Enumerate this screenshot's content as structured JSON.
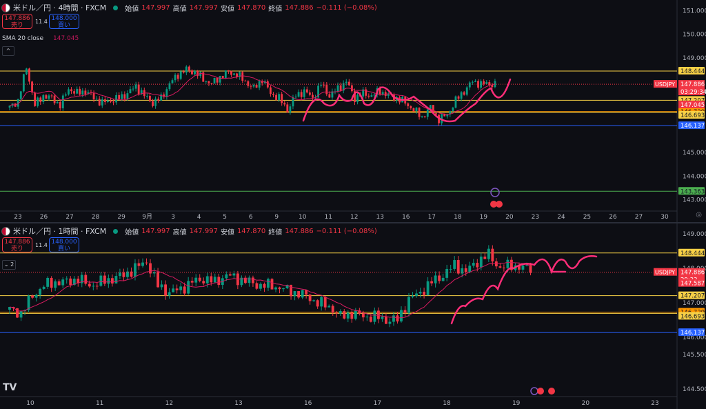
{
  "colors": {
    "background": "#0d0e14",
    "up": "#089981",
    "down": "#f23645",
    "sma": "#d81b60",
    "drawing": "#ff2d78",
    "yellow_line": "#f7d046",
    "orange_line": "#ff9800",
    "blue_line": "#2962ff",
    "green_line": "#4caf50"
  },
  "top": {
    "symbol": "米ドル／円 · 4時間 · FXCM",
    "open_label": "始値",
    "open": "147.997",
    "high_label": "高値",
    "high": "147.997",
    "low_label": "安値",
    "low": "147.870",
    "close_label": "終値",
    "close": "147.886",
    "change": "−0.111 (−0.08%)",
    "sell_price": "147.886",
    "sell_label": "売り",
    "spread": "11.4",
    "buy_price": "148.000",
    "buy_label": "買い",
    "sma_label": "SMA 20 close",
    "sma_value": "147.045",
    "collapse_icon": "^",
    "price_label_symbol": "USDJPY",
    "countdown": "03:29:34"
  },
  "bottom": {
    "symbol": "米ドル／円 · 1時間 · FXCM",
    "open_label": "始値",
    "open": "147.997",
    "high_label": "高値",
    "high": "147.997",
    "low_label": "安値",
    "low": "147.870",
    "close_label": "終値",
    "close": "147.886",
    "change": "−0.111 (−0.08%)",
    "sell_price": "147.886",
    "sell_label": "売り",
    "spread": "11.4",
    "buy_price": "148.000",
    "buy_label": "買い",
    "collapse_label": "⌄ 2",
    "price_label_symbol": "USDJPY",
    "countdown": "29:33",
    "logo": "TV"
  },
  "chart_data": [
    {
      "type": "candlestick",
      "title": "米ドル／円 · 4時間 · FXCM",
      "y_ticks": [
        "151.000",
        "150.000",
        "149.000",
        "145.000",
        "144.000",
        "143.000"
      ],
      "ylim": [
        142.7,
        151.3
      ],
      "x_ticks": [
        "23",
        "26",
        "27",
        "28",
        "29",
        "9月",
        "3",
        "4",
        "5",
        "6",
        "9",
        "10",
        "11",
        "12",
        "13",
        "16",
        "17",
        "18",
        "19",
        "20",
        "23",
        "24",
        "25",
        "26",
        "27",
        "30"
      ],
      "horizontal_levels": [
        {
          "value": 148.444,
          "label": "148.444",
          "color": "#f7d046"
        },
        {
          "value": 147.207,
          "label": "147.207",
          "color": "#f7d046"
        },
        {
          "value": 146.729,
          "label": "146.729",
          "color": "#ff9800"
        },
        {
          "value": 146.693,
          "label": "146.693",
          "color": "#f7d046"
        },
        {
          "value": 146.137,
          "label": "146.137",
          "color": "#2962ff"
        },
        {
          "value": 143.363,
          "label": "143.363",
          "color": "#4caf50"
        }
      ],
      "current_price": {
        "value": 147.886,
        "label": "147.886"
      },
      "sma_price": {
        "value": 147.045,
        "label": "147.045"
      },
      "close_path": [
        146.9,
        147.2,
        148.6,
        147.0,
        147.4,
        147.3,
        147.0,
        147.7,
        147.5,
        147.6,
        147.3,
        147.1,
        147.2,
        147.3,
        147.5,
        147.8,
        147.4,
        147.1,
        147.3,
        147.9,
        148.3,
        148.5,
        148.4,
        148.1,
        147.9,
        148.2,
        148.4,
        148.3,
        148.0,
        147.7,
        148.1,
        147.5,
        147.3,
        146.8,
        147.4,
        147.6,
        147.3,
        147.9,
        147.4,
        147.7,
        148.0,
        147.3,
        147.5,
        147.4,
        147.6,
        147.4,
        147.3,
        147.1,
        146.8,
        146.5,
        146.9,
        146.4,
        146.6,
        147.2,
        147.6,
        148.0,
        147.9,
        147.9
      ]
    },
    {
      "type": "candlestick",
      "title": "米ドル／円 · 1時間 · FXCM",
      "y_ticks": [
        "149.000",
        "148.000",
        "147.000",
        "146.000",
        "145.500",
        "144.500"
      ],
      "ylim": [
        144.4,
        149.2
      ],
      "x_ticks": [
        "10",
        "11",
        "12",
        "13",
        "16",
        "17",
        "18",
        "19",
        "20",
        "23"
      ],
      "horizontal_levels": [
        {
          "value": 148.444,
          "label": "148.444",
          "color": "#f7d046"
        },
        {
          "value": 147.207,
          "label": "147.207",
          "color": "#f7d046"
        },
        {
          "value": 146.729,
          "label": "146.729",
          "color": "#ff9800"
        },
        {
          "value": 146.693,
          "label": "146.693",
          "color": "#f7d046"
        },
        {
          "value": 146.137,
          "label": "146.137",
          "color": "#2962ff"
        }
      ],
      "current_price": {
        "value": 147.886,
        "label": "147.886"
      },
      "sma_price": {
        "value": 147.587,
        "label": "147.587"
      },
      "close_path": [
        146.8,
        146.7,
        147.2,
        147.5,
        147.6,
        147.6,
        147.7,
        147.5,
        147.6,
        147.7,
        147.8,
        148.0,
        148.2,
        147.5,
        147.3,
        147.4,
        147.6,
        147.7,
        147.6,
        147.8,
        147.7,
        147.6,
        147.5,
        147.5,
        147.4,
        147.3,
        147.2,
        147.0,
        146.9,
        146.6,
        146.7,
        146.6,
        146.6,
        146.5,
        146.5,
        147.1,
        147.3,
        147.6,
        147.8,
        148.1,
        147.9,
        148.2,
        148.4,
        148.0,
        148.1,
        148.0
      ]
    }
  ]
}
